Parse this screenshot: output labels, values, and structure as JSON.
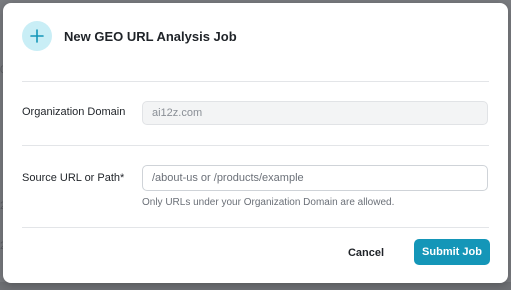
{
  "dialog": {
    "title": "New GEO URL Analysis Job",
    "icon": "plus-icon",
    "accent_color": "#1496b8"
  },
  "form": {
    "org_domain": {
      "label": "Organization Domain",
      "value": "ai12z.com"
    },
    "source_url": {
      "label": "Source URL or Path*",
      "placeholder": "/about-us or /products/example",
      "value": "",
      "help": "Only URLs under your Organization Domain are allowed."
    }
  },
  "actions": {
    "cancel_label": "Cancel",
    "submit_label": "Submit Job"
  }
}
